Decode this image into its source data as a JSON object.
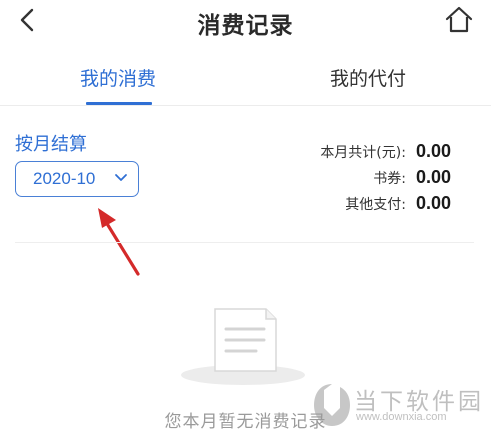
{
  "header": {
    "title": "消费记录",
    "back_icon": "chevron-left-icon",
    "home_icon": "home-icon"
  },
  "tabs": [
    {
      "label": "我的消费",
      "active": true
    },
    {
      "label": "我的代付",
      "active": false
    }
  ],
  "filter": {
    "label": "按月结算",
    "selected_month": "2020-10",
    "dropdown_icon": "chevron-down-icon"
  },
  "summary": {
    "total_label": "本月共计(元):",
    "total_value": "0.00",
    "coupon_label": "书券:",
    "coupon_value": "0.00",
    "other_label": "其他支付:",
    "other_value": "0.00"
  },
  "empty_state": {
    "text": "您本月暂无消费记录",
    "icon": "document-icon"
  },
  "watermark": {
    "name": "当下软件园",
    "url": "www.downxia.com"
  },
  "colors": {
    "accent": "#2f6fd4",
    "arrow": "#d42a2a",
    "muted": "#9a9a9a"
  }
}
